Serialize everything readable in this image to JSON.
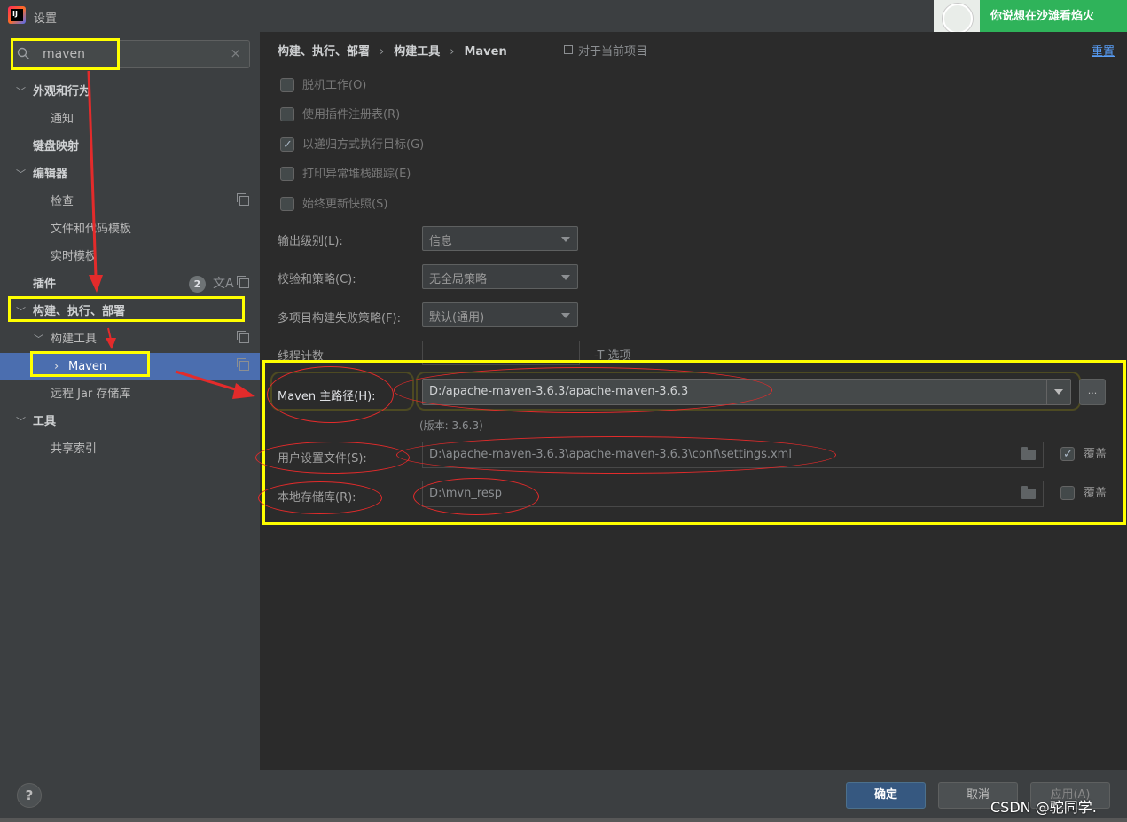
{
  "window": {
    "title": "设置"
  },
  "banner": {
    "text": "你说想在沙滩看焰火"
  },
  "search": {
    "value": "maven",
    "clear": "×"
  },
  "tree": {
    "appearance": "外观和行为",
    "notifications": "通知",
    "keymap": "键盘映射",
    "editor": "编辑器",
    "inspections": "检查",
    "file_templates": "文件和代码模板",
    "live_templates": "实时模板",
    "plugins": "插件",
    "plugins_badge": "2",
    "build": "构建、执行、部署",
    "build_tools": "构建工具",
    "maven": "Maven",
    "remote_jar": "远程 Jar 存储库",
    "tools": "工具",
    "shared_indexes": "共享索引"
  },
  "breadcrumb": {
    "part1": "构建、执行、部署",
    "part2": "构建工具",
    "part3": "Maven",
    "scope": "对于当前项目",
    "reset": "重置"
  },
  "checkboxes": {
    "offline": "脱机工作(O)",
    "plugin_registry": "使用插件注册表(R)",
    "recursive": "以递归方式执行目标(G)",
    "print_stack": "打印异常堆栈跟踪(E)",
    "always_update": "始终更新快照(S)"
  },
  "form": {
    "output_level_label": "输出级别(L):",
    "output_level_value": "信息",
    "checksum_label": "校验和策略(C):",
    "checksum_value": "无全局策略",
    "fail_label": "多项目构建失败策略(F):",
    "fail_value": "默认(通用)",
    "threads_label": "线程计数",
    "threads_value": "",
    "t_option": "-T 选项",
    "maven_home_label": "Maven 主路径(H):",
    "maven_home_value": "D:/apache-maven-3.6.3/apache-maven-3.6.3",
    "browse": "...",
    "version": "(版本: 3.6.3)",
    "user_settings_label": "用户设置文件(S):",
    "user_settings_value": "D:\\apache-maven-3.6.3\\apache-maven-3.6.3\\conf\\settings.xml",
    "override_label": "覆盖",
    "local_repo_label": "本地存储库(R):",
    "local_repo_value": "D:\\mvn_resp",
    "override_label2": "覆盖"
  },
  "footer": {
    "help": "?",
    "ok": "确定",
    "cancel": "取消",
    "apply": "应用(A)"
  },
  "watermark": "CSDN @驼同学.",
  "colors": {
    "annotation_box": "#ffff00",
    "annotation_arrow": "#e32b2b",
    "selection": "#4b6eaf",
    "link": "#589df6"
  }
}
